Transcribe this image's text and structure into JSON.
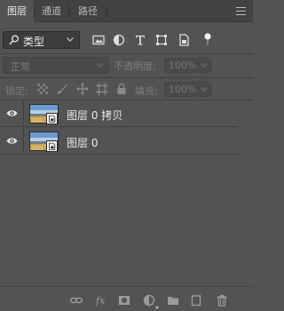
{
  "tabs": [
    {
      "label": "图层",
      "active": true
    },
    {
      "label": "通道",
      "active": false
    },
    {
      "label": "路径",
      "active": false
    }
  ],
  "filter": {
    "selected": "类型",
    "icons": [
      "pixel-filter-icon",
      "adjustment-filter-icon",
      "type-filter-icon",
      "shape-filter-icon",
      "smart-object-filter-icon",
      "filter-toggle-icon"
    ]
  },
  "blend": {
    "mode": "正常",
    "opacity_label": "不透明度:",
    "opacity_value": "100%"
  },
  "lock": {
    "label": "锁定:",
    "fill_label": "填充:",
    "fill_value": "100%"
  },
  "layers": [
    {
      "name": "图层 0 拷贝",
      "visible": true
    },
    {
      "name": "图层 0",
      "visible": true
    }
  ],
  "bottom_toolbar": [
    "link-layers-icon",
    "layer-style-icon",
    "add-mask-icon",
    "adjustment-layer-icon",
    "new-group-icon",
    "new-layer-icon",
    "delete-layer-icon"
  ],
  "colors": {
    "panel_bg": "#535353",
    "tabbar_bg": "#424242",
    "text": "#ececec",
    "disabled_text": "#7d7d7d"
  }
}
